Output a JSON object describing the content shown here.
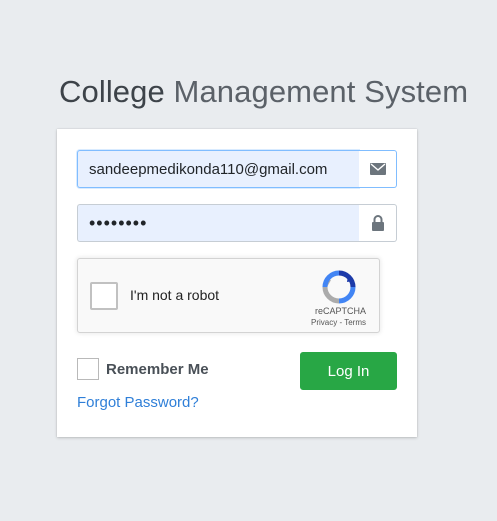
{
  "header": {
    "title_bold": "College",
    "title_rest": " Management System"
  },
  "form": {
    "email": {
      "value": "sandeepmedikonda110@gmail.com",
      "icon": "envelope-icon"
    },
    "password": {
      "value": "••••••••",
      "icon": "lock-icon"
    },
    "captcha": {
      "label": "I'm not a robot",
      "brand": "reCAPTCHA",
      "links": "Privacy - Terms"
    },
    "remember_label": "Remember Me",
    "login_label": "Log In",
    "forgot_label": "Forgot Password?"
  },
  "colors": {
    "background": "#e9ecef",
    "primary_button": "#28a745",
    "link": "#2f7fd8",
    "autofill": "#e8f0fe"
  }
}
